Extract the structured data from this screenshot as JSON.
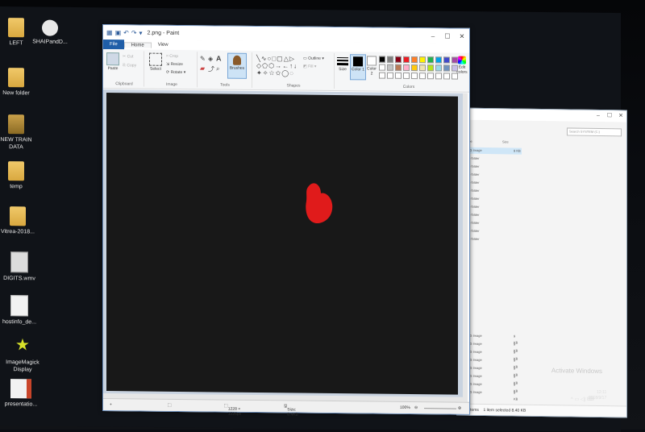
{
  "desktop": {
    "icons": [
      {
        "label": "LEFT",
        "kind": "folder"
      },
      {
        "label": "SHAIPandD...",
        "kind": "app"
      },
      {
        "label": "New folder",
        "kind": "folder"
      },
      {
        "label": "NEW TRAIN DATA",
        "kind": "folder"
      },
      {
        "label": "temp",
        "kind": "folder"
      },
      {
        "label": "Vitrea-2018...",
        "kind": "folder"
      },
      {
        "label": "DIGITS.wmv",
        "kind": "video"
      },
      {
        "label": "hostinfo_de...",
        "kind": "doc"
      },
      {
        "label": "ImageMagick Display",
        "kind": "star"
      },
      {
        "label": "presentatio...",
        "kind": "ppt"
      }
    ]
  },
  "paint": {
    "title": "2.png - Paint",
    "tabs": {
      "file": "File",
      "home": "Home",
      "view": "View"
    },
    "clipboard": {
      "paste": "Paste",
      "cut": "Cut",
      "copy": "Copy",
      "label": "Clipboard"
    },
    "image": {
      "select": "Select",
      "crop": "Crop",
      "resize": "Resize",
      "rotate": "Rotate",
      "label": "Image"
    },
    "tools": {
      "brushes": "Brushes",
      "label": "Tools"
    },
    "shapes": {
      "outline": "Outline",
      "fill": "Fill",
      "label": "Shapes"
    },
    "size": {
      "label": "Size"
    },
    "colors": {
      "color1": "Color 1",
      "color2": "Color 2",
      "edit": "Edit colors",
      "label": "Colors",
      "palette": [
        "#000000",
        "#7f7f7f",
        "#880015",
        "#ed1c24",
        "#ff7f27",
        "#fff200",
        "#22b14c",
        "#00a2e8",
        "#3f48cc",
        "#a349a4",
        "#ffffff",
        "#c3c3c3",
        "#b97a57",
        "#ffaec9",
        "#ffc90e",
        "#efe4b0",
        "#b5e61d",
        "#99d9ea",
        "#7092be",
        "#c8bfe7",
        "#ffffff",
        "#ffffff",
        "#ffffff",
        "#ffffff",
        "#ffffff",
        "#ffffff",
        "#ffffff",
        "#ffffff",
        "#ffffff",
        "#ffffff"
      ]
    },
    "status": {
      "dimensions": "1228 × 1226px",
      "filesize": "Size: 8.4KB",
      "zoom": "100%"
    },
    "canvas_bg": "#181818",
    "blob_color": "#e01b1b"
  },
  "explorer": {
    "search_placeholder": "Search SYSTEM (C:)",
    "headers": {
      "type": "Type",
      "size": "Size"
    },
    "rows": [
      {
        "type": "PNG image",
        "size": "9 KB"
      },
      {
        "type": "File folder",
        "size": ""
      },
      {
        "type": "File folder",
        "size": ""
      },
      {
        "type": "File folder",
        "size": ""
      },
      {
        "type": "File folder",
        "size": ""
      },
      {
        "type": "File folder",
        "size": ""
      },
      {
        "type": "File folder",
        "size": ""
      },
      {
        "type": "File folder",
        "size": ""
      },
      {
        "type": "File folder",
        "size": ""
      },
      {
        "type": "File folder",
        "size": ""
      },
      {
        "type": "File folder",
        "size": ""
      },
      {
        "type": "File folder",
        "size": ""
      }
    ],
    "lower_rows": [
      {
        "type": "PNG image",
        "size": "9 KB"
      },
      {
        "type": "PNG image",
        "size": "9 KB"
      },
      {
        "type": "PNG image",
        "size": "9 KB"
      },
      {
        "type": "PNG image",
        "size": "9 KB"
      },
      {
        "type": "PNG image",
        "size": "9 KB"
      },
      {
        "type": "PNG image",
        "size": "9 KB"
      },
      {
        "type": "PNG image",
        "size": "9 KB"
      },
      {
        "type": "PNG image",
        "size": "9 KB"
      }
    ],
    "status": {
      "count": "45 items",
      "selected": "1 item selected  8.40 KB"
    },
    "watermark": "Activate Windows"
  },
  "taskbar": {
    "time": "12:11",
    "date": "2018/9/17"
  }
}
